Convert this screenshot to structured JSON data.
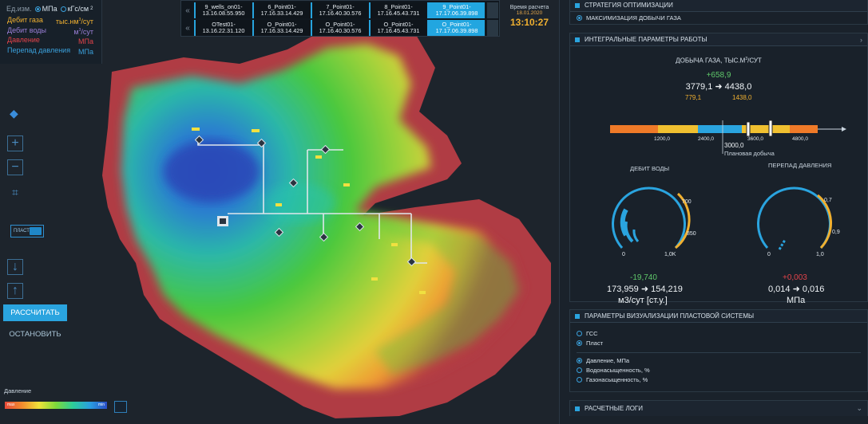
{
  "units": {
    "label": "Ед.изм.",
    "opt1": "МПа",
    "opt2": "кГс/см",
    "opt2_sup": "2",
    "rows": [
      {
        "name": "Дебит газа",
        "unit": "тыс.нм",
        "unit_sup": "3",
        "unit_suffix": "/сут",
        "color": "#f0b030"
      },
      {
        "name": "Дебит воды",
        "unit": "м",
        "unit_sup": "3",
        "unit_suffix": "/сут",
        "color": "#9a7fd6"
      },
      {
        "name": "Давление",
        "unit": "МПа",
        "unit_sup": "",
        "unit_suffix": "",
        "color": "#e2434a"
      },
      {
        "name": "Перепад давления",
        "unit": "МПа",
        "unit_sup": "",
        "unit_suffix": "",
        "color": "#3aa0db"
      }
    ]
  },
  "timeline": {
    "row1": [
      {
        "a": "9_wells_on01-",
        "b": "13.16.08.55.950"
      },
      {
        "a": "6_Point01-",
        "b": "17.16.33.14.429"
      },
      {
        "a": "7_Point01-",
        "b": "17.16.40.30.576"
      },
      {
        "a": "8_Point01-",
        "b": "17.16.45.43.731"
      },
      {
        "a": "9_Point01-",
        "b": "17.17.06.39.898"
      }
    ],
    "row2": [
      {
        "a": "OTest01-",
        "b": "13.16.22.31.120"
      },
      {
        "a": "O_Point01-",
        "b": "17.16.33.14.429"
      },
      {
        "a": "O_Point01-",
        "b": "17.16.40.30.576"
      },
      {
        "a": "O_Point01-",
        "b": "17.16.45.43.731"
      },
      {
        "a": "O_Point01-",
        "b": "17.17.06.39.898"
      }
    ],
    "chev": "«"
  },
  "calc_time": {
    "label": "Время расчета",
    "date": "18.01.2020",
    "time": "13:10:27"
  },
  "map": {
    "plast_label": "ПЛАСТ",
    "calc_btn": "РАССЧИТАТЬ",
    "stop_btn": "ОСТАНОВИТЬ",
    "legend_label": "Давление",
    "legend_max": "max",
    "legend_min": "min"
  },
  "panel": {
    "strategy": {
      "title": "СТРАТЕГИЯ ОПТИМИЗАЦИИ",
      "option": "МАКСИМИЗАЦИЯ ДОБЫЧИ ГАЗА"
    },
    "integral": {
      "title": "ИНТЕГРАЛЬНЫЕ ПАРАМЕТРЫ РАБОТЫ",
      "gas_title": "ДОБЫЧА ГАЗА, ТЫС.М",
      "gas_sup": "3",
      "gas_suffix": "/СУТ",
      "gas_delta": "+658,9",
      "gas_from": "3779,1",
      "gas_to": "4438,0",
      "gas_a": "779,1",
      "gas_b": "1438,0",
      "ticks": [
        "1200,0",
        "2400,0",
        "3600,0",
        "4800,0"
      ],
      "plan_value": "3000,0",
      "plan_label": "Плановая добыча",
      "water": {
        "title": "ДЕБИТ ВОДЫ",
        "max_a": "700",
        "max_b": "850",
        "min": "0",
        "max": "1,0K",
        "delta": "-19,740",
        "from": "173,959",
        "to": "154,219",
        "unit": "м3/сут [ст.у.]"
      },
      "dp": {
        "title": "ПЕРЕПАД ДАВЛЕНИЯ",
        "a": "0,7",
        "b": "0,9",
        "min": "0",
        "max": "1,0",
        "delta": "+0,003",
        "from": "0,014",
        "to": "0,016",
        "unit": "МПа"
      }
    },
    "vis": {
      "title": "ПАРАМЕТРЫ ВИЗУАЛИЗАЦИИ ПЛАСТОВОЙ СИСТЕМЫ",
      "o1": "ГСС",
      "o2": "Пласт",
      "o3": "Давление, МПа",
      "o4": "Водонасыщенность, %",
      "o5": "Газонасыщенность, %"
    },
    "logs": {
      "title": "РАСЧЕТНЫЕ ЛОГИ"
    }
  },
  "arrow": "➜"
}
